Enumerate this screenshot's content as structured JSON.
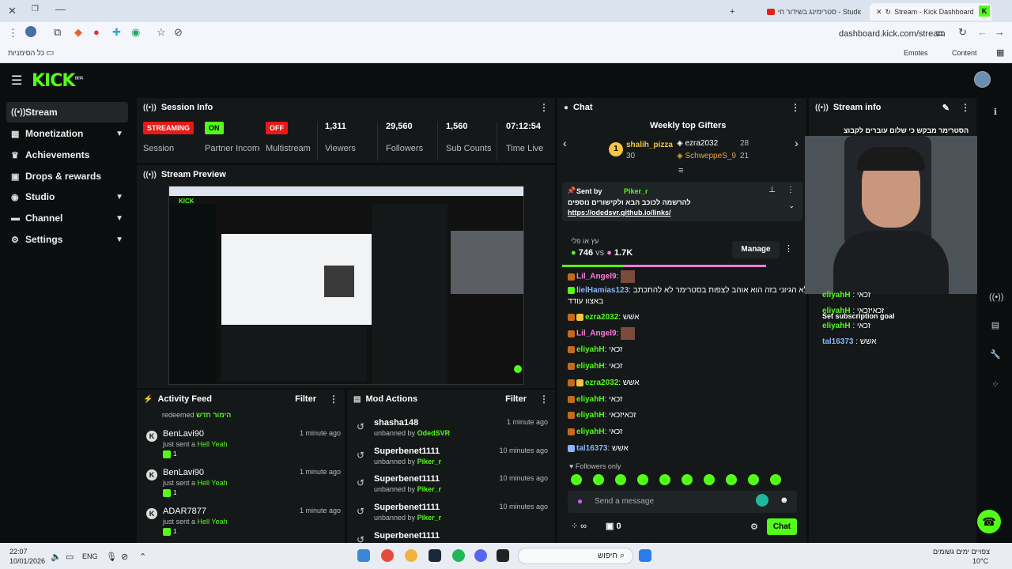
{
  "browser": {
    "tabs": [
      {
        "label": "Stream - Kick Dashboard"
      },
      {
        "label": "סטרימינג בשידור חי - Studio"
      }
    ],
    "url": "dashboard.kick.com/stream",
    "bookmarks_folder": "כל הסימניות",
    "bookmark_items": [
      "Emotes",
      "Content"
    ]
  },
  "app": {
    "logo": "KICK",
    "logo_tag": "BETA"
  },
  "sidebar": {
    "items": [
      {
        "label": "Stream",
        "icon": "stream-icon",
        "active": true,
        "expandable": false
      },
      {
        "label": "Monetization",
        "icon": "monetization-icon",
        "expandable": true
      },
      {
        "label": "Achievements",
        "icon": "trophy-icon",
        "expandable": false
      },
      {
        "label": "Drops & rewards",
        "icon": "gift-icon",
        "expandable": false
      },
      {
        "label": "Studio",
        "icon": "studio-icon",
        "expandable": true
      },
      {
        "label": "Channel",
        "icon": "channel-icon",
        "expandable": true
      },
      {
        "label": "Settings",
        "icon": "gear-icon",
        "expandable": true
      }
    ]
  },
  "session": {
    "title": "Session Info",
    "stats": [
      {
        "badge": "STREAMING",
        "label": "Session"
      },
      {
        "badge": "ON",
        "label": "Partner Income"
      },
      {
        "badge": "OFF",
        "label": "Multistream"
      },
      {
        "value": "1,311",
        "label": "Viewers"
      },
      {
        "value": "29,560",
        "label": "Followers"
      },
      {
        "value": "1,560",
        "label": "Sub Counts"
      },
      {
        "value": "07:12:54",
        "label": "Time Live"
      }
    ]
  },
  "preview": {
    "title": "Stream Preview"
  },
  "activity": {
    "title": "Activity Feed",
    "filter": "Filter",
    "top_partial": "redeemed",
    "top_partial_reward": "הימור חדש",
    "items": [
      {
        "name": "BenLavi90",
        "action": "just sent a",
        "gift": "Hell Yeah",
        "time": "1 minute ago",
        "count": "1"
      },
      {
        "name": "BenLavi90",
        "action": "just sent a",
        "gift": "Hell Yeah",
        "time": "1 minute ago",
        "count": "1"
      },
      {
        "name": "ADAR7877",
        "action": "just sent a",
        "gift": "Hell Yeah",
        "time": "1 minute ago",
        "count": "1"
      }
    ]
  },
  "mod": {
    "title": "Mod Actions",
    "filter": "Filter",
    "items": [
      {
        "name": "shasha148",
        "action": "unbanned by",
        "by": "OdedSVR",
        "time": "1 minute ago"
      },
      {
        "name": "Superbenet1111",
        "action": "unbanned by",
        "by": "Piker_r",
        "time": "10 minutes ago"
      },
      {
        "name": "Superbenet1111",
        "action": "unbanned by",
        "by": "Piker_r",
        "time": "10 minutes ago"
      },
      {
        "name": "Superbenet1111",
        "action": "unbanned by",
        "by": "Piker_r",
        "time": "10 minutes ago"
      },
      {
        "name": "Superbenet1111",
        "action": "",
        "by": "",
        "time": ""
      }
    ]
  },
  "chat": {
    "title": "Chat",
    "gifters_title": "Weekly top Gifters",
    "first": {
      "rank": "1",
      "name": "shalih_pizza",
      "count": "30"
    },
    "second": {
      "name": "ezra2032",
      "count": "28"
    },
    "third": {
      "name": "SchweppeS_9",
      "count": "21"
    },
    "pinned": {
      "sent_by": "Sent by",
      "author": "Piker_r",
      "text": "להרשמה לכוכב הבא ולקישורים נוספים",
      "link": "https://odedsvr.github.io/links/"
    },
    "poll": {
      "question": "עץ או פלי",
      "left": "746",
      "vs": "vs",
      "right": "1.7K",
      "manage": "Manage",
      "left_share": 0.3
    },
    "messages": [
      {
        "user": "Lil_Angel9",
        "text": "",
        "color": "pink"
      },
      {
        "user": "lielHamias123",
        "text": "מה לא הגיוני בזה הוא אוהב לצפות בסטרימר לא להתכתב",
        "color": "blue"
      },
      {
        "user": "",
        "text": "באצוו עודד",
        "color": ""
      },
      {
        "user": "ezra2032",
        "text": "אשש",
        "color": "green"
      },
      {
        "user": "Lil_Angel9",
        "text": "",
        "color": "pink"
      },
      {
        "user": "eliyahH",
        "text": "זכאי",
        "color": "green"
      },
      {
        "user": "eliyahH",
        "text": "זכאי",
        "color": "green"
      },
      {
        "user": "ezra2032",
        "text": "אשש",
        "color": "green"
      },
      {
        "user": "eliyahH",
        "text": "זכאי",
        "color": "green"
      },
      {
        "user": "eliyahH",
        "text": "זכאיזכאי",
        "color": "green"
      },
      {
        "user": "eliyahH",
        "text": "זכאי",
        "color": "green"
      },
      {
        "user": "tal16373",
        "text": "אשש",
        "color": "blue"
      }
    ],
    "followers_only": "Followers only",
    "input_placeholder": "Send a message",
    "points": "0",
    "send": "Chat"
  },
  "stream_info": {
    "title": "Stream info",
    "header_text": "הסטרימר מבקש כי שלום עוברים לקבוצ",
    "overlay": [
      {
        "user": "eliyahH",
        "text": "זכאי"
      },
      {
        "user": "eliyahH",
        "text": "זכאיזכאי"
      },
      {
        "user": "eliyahH",
        "text": "זכאי"
      },
      {
        "user": "tal16373",
        "text": "אשש"
      }
    ],
    "overlay_goal": "Set subscription goal"
  },
  "taskbar": {
    "time": "22:07",
    "date": "10/01/2026",
    "lang": "ENG",
    "search": "חיפוש",
    "weather_line1": "צפויים ימים גשומים",
    "weather_line2": "10°C"
  },
  "colors": {
    "accent": "#53fc18",
    "streaming": "#e91916",
    "panel": "#141819"
  }
}
